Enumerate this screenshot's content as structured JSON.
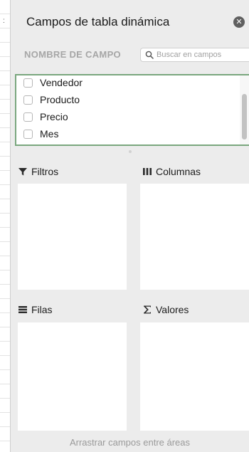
{
  "pane": {
    "title": "Campos de tabla dinámica",
    "close_glyph": "✕"
  },
  "fields": {
    "header_label": "NOMBRE DE CAMPO",
    "search_placeholder": "Buscar en campos",
    "items": [
      {
        "label": "Vendedor",
        "checked": false
      },
      {
        "label": "Producto",
        "checked": false
      },
      {
        "label": "Precio",
        "checked": false
      },
      {
        "label": "Mes",
        "checked": false
      }
    ]
  },
  "areas": {
    "filters": {
      "label": "Filtros",
      "icon": "filter-icon"
    },
    "columns": {
      "label": "Columnas",
      "icon": "columns-icon"
    },
    "rows": {
      "label": "Filas",
      "icon": "rows-icon"
    },
    "values": {
      "label": "Valores",
      "icon": "sigma-icon"
    }
  },
  "footer": {
    "hint": "Arrastrar campos entre áreas"
  },
  "colors": {
    "list_focus_border": "#7aa77e",
    "pane_background": "#ececec"
  }
}
